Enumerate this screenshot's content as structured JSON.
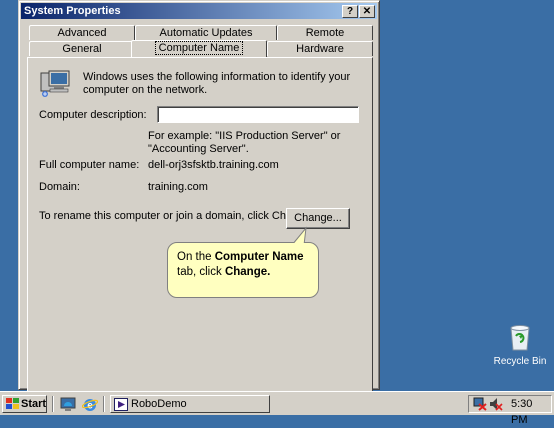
{
  "window": {
    "title": "System Properties",
    "help_label": "?",
    "close_label": "✕"
  },
  "tabs": {
    "row1": [
      "Advanced",
      "Automatic Updates",
      "Remote"
    ],
    "row2": [
      "General",
      "Computer Name",
      "Hardware"
    ],
    "selected": "Computer Name"
  },
  "panel": {
    "intro": "Windows uses the following information to identify your computer on the network.",
    "description_label": "Computer description:",
    "description_value": "",
    "example_text": "For example: \"IIS Production Server\" or \"Accounting Server\".",
    "full_name_label": "Full computer name:",
    "full_name_value": "dell-orj3sfsktb.training.com",
    "domain_label": "Domain:",
    "domain_value": "training.com",
    "rename_text": "To rename this computer or join a domain, click Change.",
    "change_button": "Change..."
  },
  "callout": {
    "prefix": "On the ",
    "bold1": "Computer Name",
    "middle": " tab, click ",
    "bold2": "Change."
  },
  "desktop": {
    "recycle_bin_label": "Recycle Bin"
  },
  "taskbar": {
    "start_label": "Start",
    "task_label": "RoboDemo",
    "clock": "5:30 PM"
  },
  "icons": [
    "computer-icon",
    "recycle-bin-icon",
    "windows-logo-icon",
    "desktop-icon",
    "ie-icon",
    "robodemo-icon",
    "network-icon",
    "volume-icon"
  ]
}
